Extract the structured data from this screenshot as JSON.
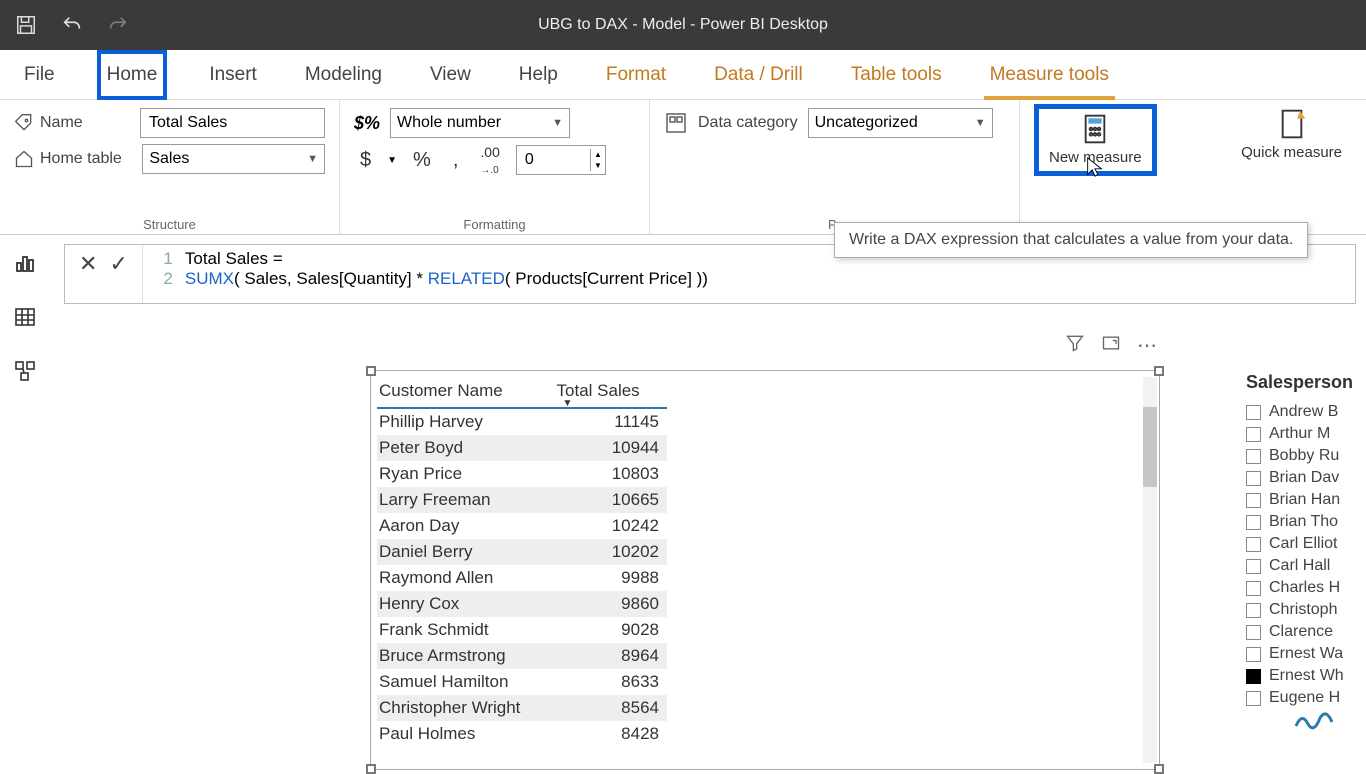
{
  "app_title": "UBG to DAX - Model - Power BI Desktop",
  "tabs": {
    "file": "File",
    "home": "Home",
    "insert": "Insert",
    "modeling": "Modeling",
    "view": "View",
    "help": "Help",
    "format": "Format",
    "data_drill": "Data / Drill",
    "table_tools": "Table tools",
    "measure_tools": "Measure tools"
  },
  "ribbon": {
    "structure": {
      "label": "Structure",
      "name_label": "Name",
      "name_value": "Total Sales",
      "home_table_label": "Home table",
      "home_table_value": "Sales"
    },
    "formatting": {
      "label": "Formatting",
      "format_value": "Whole number",
      "decimals_value": "0",
      "dollar": "$",
      "percent": "%",
      "comma": ",",
      "precision": ".00→.0"
    },
    "properties": {
      "label": "Pr",
      "data_category_label": "Data category",
      "data_category_value": "Uncategorized"
    },
    "calculations": {
      "new_measure": "New measure",
      "quick_measure": "Quick measure"
    }
  },
  "tooltip": "Write a DAX expression that calculates a value from your data.",
  "formula": {
    "line1_num": "1",
    "line1_text": "Total Sales =",
    "line2_num": "2",
    "line2_kw1": "SUMX",
    "line2_mid": "( Sales, Sales[Quantity] * ",
    "line2_kw2": "RELATED",
    "line2_end": "( Products[Current Price] ))"
  },
  "table": {
    "col1": "Customer Name",
    "col2": "Total Sales",
    "rows": [
      {
        "name": "Phillip Harvey",
        "value": "11145"
      },
      {
        "name": "Peter Boyd",
        "value": "10944"
      },
      {
        "name": "Ryan Price",
        "value": "10803"
      },
      {
        "name": "Larry Freeman",
        "value": "10665"
      },
      {
        "name": "Aaron Day",
        "value": "10242"
      },
      {
        "name": "Daniel Berry",
        "value": "10202"
      },
      {
        "name": "Raymond Allen",
        "value": "9988"
      },
      {
        "name": "Henry Cox",
        "value": "9860"
      },
      {
        "name": "Frank Schmidt",
        "value": "9028"
      },
      {
        "name": "Bruce Armstrong",
        "value": "8964"
      },
      {
        "name": "Samuel Hamilton",
        "value": "8633"
      },
      {
        "name": "Christopher Wright",
        "value": "8564"
      },
      {
        "name": "Paul Holmes",
        "value": "8428"
      }
    ]
  },
  "slicer": {
    "title": "Salesperson",
    "items": [
      {
        "label": "Andrew B",
        "checked": false
      },
      {
        "label": "Arthur M",
        "checked": false
      },
      {
        "label": "Bobby Ru",
        "checked": false
      },
      {
        "label": "Brian Dav",
        "checked": false
      },
      {
        "label": "Brian Han",
        "checked": false
      },
      {
        "label": "Brian Tho",
        "checked": false
      },
      {
        "label": "Carl Elliot",
        "checked": false
      },
      {
        "label": "Carl Hall",
        "checked": false
      },
      {
        "label": "Charles H",
        "checked": false
      },
      {
        "label": "Christoph",
        "checked": false
      },
      {
        "label": "Clarence",
        "checked": false
      },
      {
        "label": "Ernest Wa",
        "checked": false
      },
      {
        "label": "Ernest Wh",
        "checked": true
      },
      {
        "label": "Eugene H",
        "checked": false
      }
    ]
  }
}
